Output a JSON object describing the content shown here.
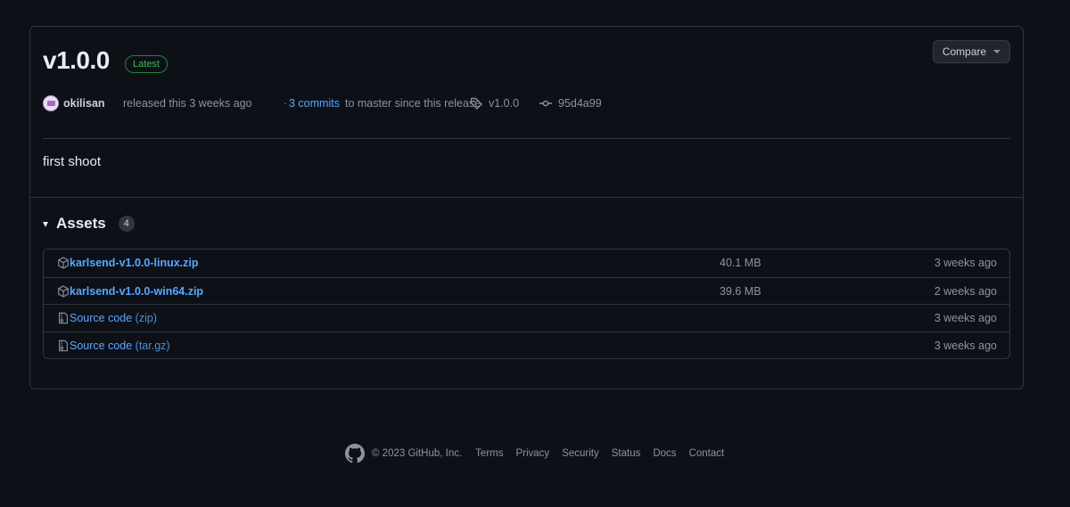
{
  "release": {
    "version": "v1.0.0",
    "badge": "Latest",
    "compare_label": "Compare",
    "user": "okilisan",
    "released_text": "released this 3 weeks ago",
    "commits_prefix": "·",
    "commits_link": "3 commits",
    "commits_suffix": "to master since this release",
    "tag": "v1.0.0",
    "commit_hash": "95d4a99",
    "body": "first shoot"
  },
  "assets": {
    "title": "Assets",
    "count": "4",
    "items": [
      {
        "name": "karlsend-v1.0.0-linux.zip",
        "size": "40.1 MB",
        "date": "3 weeks ago",
        "icon": "package-icon"
      },
      {
        "name": "karlsend-v1.0.0-win64.zip",
        "size": "39.6 MB",
        "date": "2 weeks ago",
        "icon": "package-icon"
      },
      {
        "name": "Source code",
        "ext": "(zip)",
        "size": "",
        "date": "3 weeks ago",
        "icon": "file-zip-icon"
      },
      {
        "name": "Source code",
        "ext": "(tar.gz)",
        "size": "",
        "date": "3 weeks ago",
        "icon": "file-zip-icon"
      }
    ]
  },
  "footer": {
    "copyright": "© 2023 GitHub, Inc.",
    "links": [
      "Terms",
      "Privacy",
      "Security",
      "Status",
      "Docs",
      "Contact"
    ]
  },
  "colors": {
    "background": "#0d1117",
    "link": "#58a6ff",
    "latest_badge": "#3fb950",
    "border": "#30363d"
  }
}
